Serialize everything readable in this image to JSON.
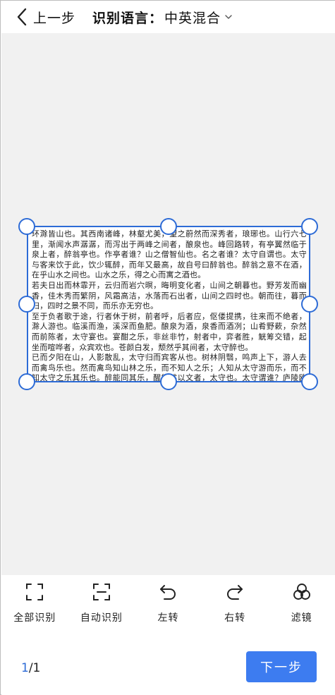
{
  "header": {
    "back_label": "上一步",
    "lang_label": "识别语言：",
    "lang_value": "中英混合"
  },
  "document": {
    "paragraphs": [
      "环滁皆山也。其西南诸峰，林壑尤美，望之蔚然而深秀者，琅琊也。山行六七里，渐闻水声潺潺，而泻出于两峰之间者，酿泉也。峰回路转，有亭翼然临于泉上者，醉翁亭也。作亭者谁？山之僧智仙也。名之者谁？太守自谓也。太守与客来饮于此，饮少辄醉，而年又最高，故自号曰醉翁也。醉翁之意不在酒，在乎山水之间也。山水之乐，得之心而寓之酒也。",
      "若夫日出而林霏开，云归而岩穴暝，晦明变化者，山间之朝暮也。野芳发而幽香，佳木秀而繁阴，风霜高洁，水落而石出者，山间之四时也。朝而往，暮而归，四时之景不同，而乐亦无穷也。",
      "至于负者歌于途，行者休于树，前者呼，后者应，伛偻提携，往来而不绝者，滁人游也。临溪而渔，溪深而鱼肥。酿泉为酒，泉香而酒冽；山肴野蔌，杂然而前陈者，太守宴也。宴酣之乐，非丝非竹，射者中，弈者胜，觥筹交错，起坐而喧哗者，众宾欢也。苍颜白发，颓然乎其间者，太守醉也。",
      "已而夕阳在山，人影散乱，太守归而宾客从也。树林阴翳，鸣声上下，游人去而禽鸟乐也。然而禽鸟知山林之乐，而不知人之乐；人知从太守游而乐，而不知太守之乐其乐也。醉能同其乐，醒能述以文者，太守也。太守谓谁？庐陵欧阳修也。"
    ]
  },
  "toolbar": {
    "items": [
      {
        "label": "全部识别",
        "icon": "full-frame-icon"
      },
      {
        "label": "自动识别",
        "icon": "auto-detect-icon"
      },
      {
        "label": "左转",
        "icon": "rotate-left-icon"
      },
      {
        "label": "右转",
        "icon": "rotate-right-icon"
      },
      {
        "label": "滤镜",
        "icon": "filter-icon"
      }
    ]
  },
  "pagination": {
    "current": "1",
    "total": "/1"
  },
  "next_button": "下一步",
  "colors": {
    "accent": "#2d6bd6",
    "button": "#3d7cf0",
    "canvas_bg": "#f1f1f1"
  }
}
